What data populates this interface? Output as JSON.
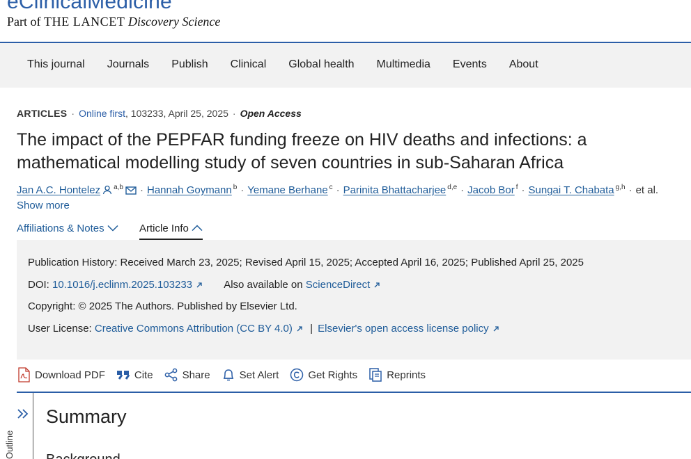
{
  "brand": {
    "name": "eClinicalMedicine",
    "sub_prefix": "Part of",
    "sub_lancet": "THE LANCET",
    "sub_discovery": "Discovery Science"
  },
  "nav": [
    "This journal",
    "Journals",
    "Publish",
    "Clinical",
    "Global health",
    "Multimedia",
    "Events",
    "About"
  ],
  "meta": {
    "articles": "ARTICLES",
    "online_first": "Online first",
    "details": ", 103233, April 25, 2025",
    "open_access": "Open Access"
  },
  "title": "The impact of the PEPFAR funding freeze on HIV deaths and infections: a mathematical modelling study of seven countries in sub-Saharan Africa",
  "authors": [
    {
      "name": "Jan A.C. Hontelez",
      "sup": "a,b"
    },
    {
      "name": "Hannah Goymann",
      "sup": "b"
    },
    {
      "name": "Yemane Berhane",
      "sup": "c"
    },
    {
      "name": "Parinita Bhattacharjee",
      "sup": "d,e"
    },
    {
      "name": "Jacob Bor",
      "sup": "f"
    },
    {
      "name": "Sungai T. Chabata",
      "sup": "g,h"
    }
  ],
  "authors_more": "et al.",
  "show_more": "Show more",
  "tabs": {
    "affiliations": "Affiliations & Notes",
    "article_info": "Article Info"
  },
  "info": {
    "history": "Publication History:  Received March 23, 2025; Revised April 15, 2025; Accepted April 16, 2025; Published April 25, 2025",
    "doi_label": "DOI:",
    "doi_value": "10.1016/j.eclinm.2025.103233",
    "also_label": "Also available on",
    "also_link": "ScienceDirect",
    "copyright": "Copyright: © 2025 The Authors. Published by Elsevier Ltd.",
    "license_label": "User License:",
    "license_link": "Creative Commons Attribution (CC BY 4.0)",
    "license_sep": "|",
    "policy_link": "Elsevier's open access license policy"
  },
  "actions": {
    "download": "Download PDF",
    "cite": "Cite",
    "share": "Share",
    "alert": "Set Alert",
    "rights": "Get Rights",
    "reprints": "Reprints"
  },
  "outline_label": "Outline",
  "summary_heading": "Summary",
  "background_heading": "Background",
  "colors": {
    "brand_blue": "#2b5ea7",
    "link_blue": "#1f5c99",
    "panel_gray": "#f2f2f2"
  }
}
